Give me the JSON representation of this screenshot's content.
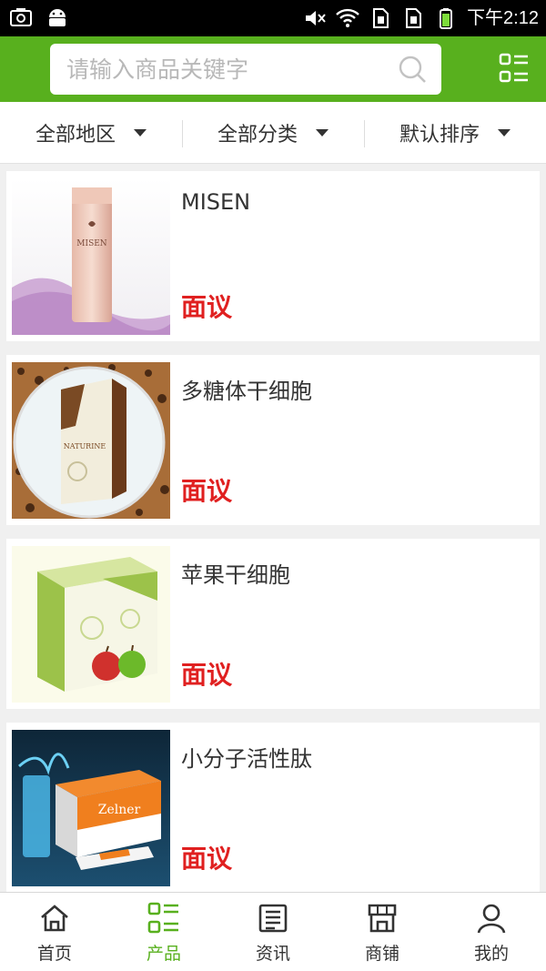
{
  "status_bar": {
    "time": "下午2:12"
  },
  "search": {
    "placeholder": "请输入商品关键字"
  },
  "filters": [
    {
      "label": "全部地区"
    },
    {
      "label": "全部分类"
    },
    {
      "label": "默认排序"
    }
  ],
  "products": [
    {
      "name": "MISEN",
      "price": "面议"
    },
    {
      "name": "多糖体干细胞",
      "price": "面议"
    },
    {
      "name": "苹果干细胞",
      "price": "面议"
    },
    {
      "name": "小分子活性肽",
      "price": "面议"
    }
  ],
  "tabs": [
    {
      "label": "首页"
    },
    {
      "label": "产品"
    },
    {
      "label": "资讯"
    },
    {
      "label": "商铺"
    },
    {
      "label": "我的"
    }
  ],
  "colors": {
    "brand_green": "#58b01e",
    "price_red": "#e02020"
  },
  "product_image_text": {
    "misen": "MISEN",
    "naturine": "NATURINE",
    "zelner": "Zelner"
  }
}
